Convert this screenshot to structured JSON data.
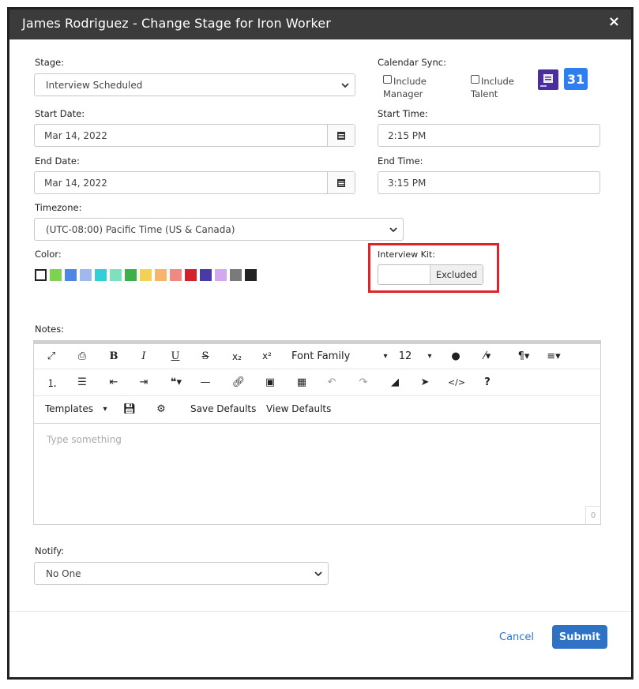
{
  "dialog": {
    "title": "James Rodriguez - Change Stage for Iron Worker",
    "close_label": "×"
  },
  "stage": {
    "label": "Stage:",
    "value": "Interview Scheduled"
  },
  "calendar_sync": {
    "label": "Calendar Sync:",
    "include_manager": "Include Manager",
    "include_talent": "Include Talent",
    "outlook_icon": "outlook-calendar-icon",
    "google_icon": "google-calendar-icon",
    "google_text": "31"
  },
  "start_date": {
    "label": "Start Date:",
    "value": "Mar 14, 2022"
  },
  "start_time": {
    "label": "Start Time:",
    "value": "2:15 PM"
  },
  "end_date": {
    "label": "End Date:",
    "value": "Mar 14, 2022"
  },
  "end_time": {
    "label": "End Time:",
    "value": "3:15 PM"
  },
  "timezone": {
    "label": "Timezone:",
    "value": "(UTC-08:00) Pacific Time (US & Canada)"
  },
  "color": {
    "label": "Color:",
    "swatches": [
      "#ffffff",
      "#7dd24f",
      "#4e86e8",
      "#9fb8f0",
      "#33cfd8",
      "#7fe0c0",
      "#3db04a",
      "#f2d255",
      "#f6b56a",
      "#f08a80",
      "#d4202a",
      "#4a3aa8",
      "#d3a8ef",
      "#7a7a7a",
      "#222222"
    ]
  },
  "interview_kit": {
    "label": "Interview Kit:",
    "value": "Excluded"
  },
  "notes": {
    "label": "Notes:",
    "placeholder": "Type something",
    "char_count": "0",
    "toolbar": {
      "font_family": "Font Family",
      "font_size": "12",
      "templates": "Templates",
      "save_defaults": "Save Defaults",
      "view_defaults": "View Defaults"
    }
  },
  "notify": {
    "label": "Notify:",
    "value": "No One"
  },
  "footer": {
    "cancel": "Cancel",
    "submit": "Submit"
  },
  "colors": {
    "accent": "#2d72c4",
    "title_bar": "#3b3b3b",
    "highlight": "#e0232b"
  }
}
